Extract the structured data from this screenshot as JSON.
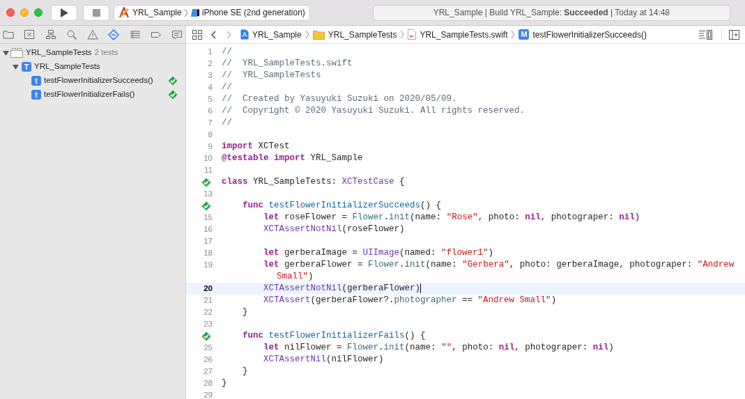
{
  "toolbar": {
    "scheme": {
      "project": "YRL_Sample",
      "device": "iPhone SE (2nd generation)"
    },
    "activity": "YRL_Sample | Build YRL_Sample: **Succeeded** | Today at 14:48"
  },
  "navigator_tabs": [
    {
      "selected": false
    },
    {
      "selected": false
    },
    {
      "selected": false
    },
    {
      "selected": false
    },
    {
      "selected": false
    },
    {
      "selected": true
    },
    {
      "selected": false
    },
    {
      "selected": false
    },
    {
      "selected": false
    }
  ],
  "test_tree": [
    {
      "label": "YRL_SampleTests",
      "count": "2 tests",
      "expanded": true,
      "children": [
        {
          "label": "YRL_SampleTests",
          "badge": "T",
          "expanded": true,
          "children": [
            {
              "label": "testFlowerInitializerSucceeds()",
              "badge": "t",
              "passed": true
            },
            {
              "label": "testFlowerInitializerFails()",
              "badge": "t",
              "passed": true
            }
          ]
        }
      ]
    }
  ],
  "jump_bar": {
    "forward_disabled": true,
    "crumbs": [
      {
        "kind": "project",
        "label": "YRL_Sample"
      },
      {
        "kind": "folder",
        "label": "YRL_SampleTests"
      },
      {
        "kind": "swift",
        "label": "YRL_SampleTests.swift"
      },
      {
        "kind": "method",
        "badge": "M",
        "label": "testFlowerInitializerSucceeds()"
      }
    ]
  },
  "editor": {
    "lines": [
      {
        "number": "1",
        "current": false,
        "tokens": [
          {
            "kind": "comment",
            "text": "//"
          }
        ]
      },
      {
        "number": "2",
        "current": false,
        "tokens": [
          {
            "kind": "comment",
            "text": "//  YRL_SampleTests.swift"
          }
        ]
      },
      {
        "number": "3",
        "current": false,
        "tokens": [
          {
            "kind": "comment",
            "text": "//  YRL_SampleTests"
          }
        ]
      },
      {
        "number": "4",
        "current": false,
        "tokens": [
          {
            "kind": "comment",
            "text": "//"
          }
        ]
      },
      {
        "number": "5",
        "current": false,
        "tokens": [
          {
            "kind": "comment",
            "text": "//  Created by Yasuyuki Suzuki on 2020/05/09."
          }
        ]
      },
      {
        "number": "6",
        "current": false,
        "tokens": [
          {
            "kind": "comment",
            "text": "//  Copyright © 2020 Yasuyuki Suzuki. All rights reserved."
          }
        ]
      },
      {
        "number": "7",
        "current": false,
        "tokens": [
          {
            "kind": "comment",
            "text": "//"
          }
        ]
      },
      {
        "number": "8",
        "current": false
      },
      {
        "number": "9",
        "current": false,
        "tokens": [
          {
            "kind": "keyword",
            "text": "import"
          },
          {
            "text": " XCTest"
          }
        ]
      },
      {
        "number": "10",
        "current": false,
        "tokens": [
          {
            "kind": "keyword",
            "text": "@testable import"
          },
          {
            "text": " YRL_Sample"
          }
        ]
      },
      {
        "number": "11",
        "current": false
      },
      {
        "test_passed": true,
        "current": false,
        "tokens": [
          {
            "kind": "keyword",
            "text": "class"
          },
          {
            "text": " YRL_SampleTests: "
          },
          {
            "kind": "type",
            "text": "XCTestCase"
          },
          {
            "text": " {"
          }
        ]
      },
      {
        "number": "13",
        "current": false
      },
      {
        "test_passed": true,
        "current": false,
        "tokens": [
          {
            "kind": "keyword",
            "text": "    func "
          },
          {
            "kind": "declaration",
            "text": "testFlowerInitializerSucceeds"
          },
          {
            "text": "() {"
          }
        ]
      },
      {
        "number": "15",
        "current": false,
        "tokens": [
          {
            "kind": "keyword",
            "text": "        let"
          },
          {
            "text": " roseFlower = "
          },
          {
            "kind": "project",
            "text": "Flower"
          },
          {
            "text": "."
          },
          {
            "kind": "project",
            "text": "init"
          },
          {
            "text": "(name: "
          },
          {
            "kind": "string",
            "text": "\"Rose\""
          },
          {
            "text": ", photo: "
          },
          {
            "kind": "keyword",
            "text": "nil"
          },
          {
            "text": ", photograper: "
          },
          {
            "kind": "keyword",
            "text": "nil"
          },
          {
            "text": ")"
          }
        ]
      },
      {
        "number": "16",
        "current": false,
        "tokens": [
          {
            "kind": "type",
            "text": "        XCTAssertNotNil"
          },
          {
            "text": "(roseFlower)"
          }
        ]
      },
      {
        "number": "17",
        "current": false
      },
      {
        "number": "18",
        "current": false,
        "tokens": [
          {
            "kind": "keyword",
            "text": "        let"
          },
          {
            "text": " gerberaImage = "
          },
          {
            "kind": "type",
            "text": "UIImage"
          },
          {
            "text": "(named: "
          },
          {
            "kind": "string",
            "text": "\"flower1\""
          },
          {
            "text": ")"
          }
        ]
      },
      {
        "number": "19",
        "current": false,
        "tokens": [
          {
            "kind": "keyword",
            "text": "        let"
          },
          {
            "text": " gerberaFlower = "
          },
          {
            "kind": "project",
            "text": "Flower"
          },
          {
            "text": "."
          },
          {
            "kind": "project",
            "text": "init"
          },
          {
            "text": "(name: "
          },
          {
            "kind": "string",
            "text": "\"Gerbera\""
          },
          {
            "text": ", photo: gerberaImage, photograper: "
          },
          {
            "kind": "string",
            "text": "\"Andrew Small\""
          },
          {
            "text": ")"
          }
        ]
      },
      {
        "number": "20",
        "current": true,
        "tokens": [
          {
            "kind": "type",
            "text": "        XCTAssertNotNil"
          },
          {
            "text": "(gerberaFlower)"
          }
        ]
      },
      {
        "number": "21",
        "current": false,
        "tokens": [
          {
            "kind": "type",
            "text": "        XCTAssert"
          },
          {
            "text": "(gerberaFlower?."
          },
          {
            "kind": "project",
            "text": "photographer"
          },
          {
            "text": " == "
          },
          {
            "kind": "string",
            "text": "\"Andrew Small\""
          },
          {
            "text": ")"
          }
        ]
      },
      {
        "number": "22",
        "current": false,
        "tokens": [
          {
            "text": "    }"
          }
        ]
      },
      {
        "number": "23",
        "current": false
      },
      {
        "test_passed": true,
        "current": false,
        "tokens": [
          {
            "kind": "keyword",
            "text": "    func "
          },
          {
            "kind": "declaration",
            "text": "testFlowerInitializerFails"
          },
          {
            "text": "() {"
          }
        ]
      },
      {
        "number": "25",
        "current": false,
        "tokens": [
          {
            "kind": "keyword",
            "text": "        let"
          },
          {
            "text": " nilFlower = "
          },
          {
            "kind": "project",
            "text": "Flower"
          },
          {
            "text": "."
          },
          {
            "kind": "project",
            "text": "init"
          },
          {
            "text": "(name: "
          },
          {
            "kind": "string",
            "text": "\"\""
          },
          {
            "text": ", photo: "
          },
          {
            "kind": "keyword",
            "text": "nil"
          },
          {
            "text": ", photograper: "
          },
          {
            "kind": "keyword",
            "text": "nil"
          },
          {
            "text": ")"
          }
        ]
      },
      {
        "number": "26",
        "current": false,
        "tokens": [
          {
            "kind": "type",
            "text": "        XCTAssertNil"
          },
          {
            "text": "(nilFlower)"
          }
        ]
      },
      {
        "number": "27",
        "current": false,
        "tokens": [
          {
            "text": "    }"
          }
        ]
      },
      {
        "number": "28",
        "current": false,
        "tokens": [
          {
            "text": "}"
          }
        ]
      },
      {
        "number": "29",
        "current": false
      }
    ]
  }
}
